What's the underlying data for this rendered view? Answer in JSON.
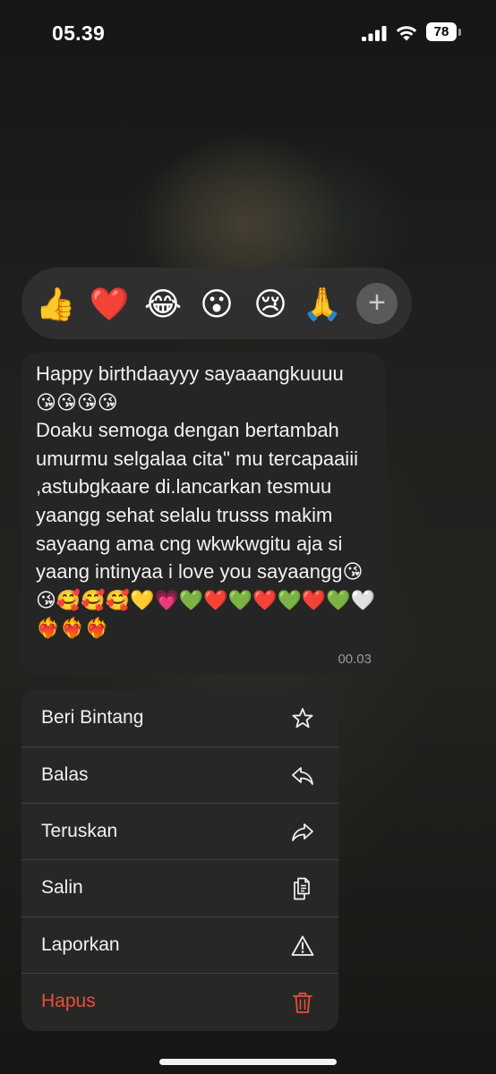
{
  "status_bar": {
    "time": "05.39",
    "battery": "78"
  },
  "reactions": [
    {
      "emoji": "👍",
      "icon": "thumbs-up"
    },
    {
      "emoji": "❤️",
      "icon": "red-heart"
    },
    {
      "emoji": "😂",
      "icon": "tears-of-joy"
    },
    {
      "emoji": "😮",
      "icon": "surprised-face"
    },
    {
      "emoji": "😢",
      "icon": "crying-face"
    },
    {
      "emoji": "🙏",
      "icon": "folded-hands"
    }
  ],
  "reaction_more": "+",
  "message": {
    "text": "Happy birthdaayyy sayaaangkuuuu\n😘😘😘😘\nDoaku semoga dengan bertambah umurmu selgalaa cita\" mu tercapaaiii ,astubgkaare di.lancarkan tesmuu yaangg sehat selalu trusss makim sayaang ama cng wkwkwgitu aja si yaang intinyaa i love you sayaangg😘😘🥰🥰🥰💛💗💚❤️💚❤️💚❤️💚🤍❤️‍🔥❤️‍🔥❤️‍🔥",
    "time": "00.03"
  },
  "menu": {
    "items": [
      {
        "label": "Beri Bintang",
        "icon": "star-icon"
      },
      {
        "label": "Balas",
        "icon": "reply-icon"
      },
      {
        "label": "Teruskan",
        "icon": "forward-icon"
      },
      {
        "label": "Salin",
        "icon": "copy-icon"
      },
      {
        "label": "Laporkan",
        "icon": "warning-icon"
      },
      {
        "label": "Hapus",
        "icon": "trash-icon"
      }
    ]
  },
  "colors": {
    "danger": "#eb4d3d",
    "bubble": "#252525",
    "menu": "#282828"
  }
}
